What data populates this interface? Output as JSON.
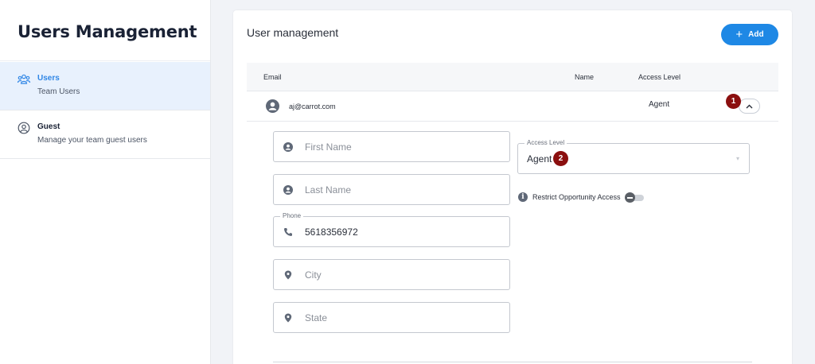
{
  "sidebar": {
    "title": "Users Management",
    "items": [
      {
        "label": "Users",
        "sub": "Team Users",
        "icon": "users-icon",
        "active": true
      },
      {
        "label": "Guest",
        "sub": "Manage your team guest users",
        "icon": "guest-icon",
        "active": false
      }
    ]
  },
  "main": {
    "title": "User management",
    "add_label": "Add",
    "columns": {
      "email": "Email",
      "name": "Name",
      "access": "Access Level"
    },
    "row": {
      "email": "aj@carrot.com",
      "access": "Agent"
    },
    "badges": [
      "1",
      "2"
    ],
    "form": {
      "first_name_placeholder": "First Name",
      "last_name_placeholder": "Last Name",
      "phone_label": "Phone",
      "phone_value": "5618356972",
      "city_placeholder": "City",
      "state_placeholder": "State",
      "access_level_label": "Access Level",
      "access_level_value": "Agent",
      "restrict_label": "Restrict Opportunity Access",
      "restrict_enabled": false
    }
  },
  "colors": {
    "accent": "#1e88e5",
    "active_bg": "#e8f1fd",
    "badge": "#8b0f0f"
  }
}
